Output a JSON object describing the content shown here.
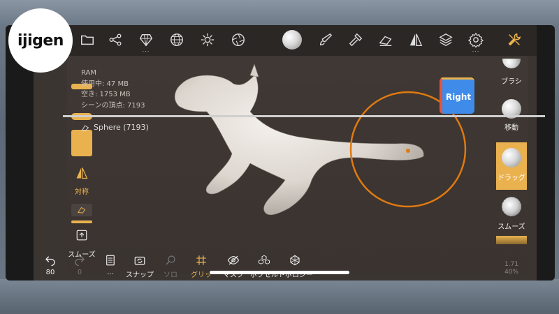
{
  "logo": {
    "text": "ijigen"
  },
  "ram": {
    "title": "RAM",
    "used": "使用中: 47 MB",
    "free": "空き: 1753 MB",
    "vertices": "シーンの頂点: 7193"
  },
  "object": {
    "name": "Sphere (7193)"
  },
  "navcube": {
    "label": "Right"
  },
  "left_panel": {
    "symmetry_label": "対称",
    "smooth_label": "スムーズ"
  },
  "right_panel": {
    "brush_label": "ブラシ",
    "move_label": "移動",
    "drag_label": "ドラッグ",
    "smooth_label": "スムーズ"
  },
  "bottom_toolbar": {
    "undo_count": "80",
    "redo_count": "0",
    "layers_dots": "...",
    "snap_label": "スナップ",
    "solo_label": "ソロ",
    "grid_label": "グリッ",
    "mask_label": "マスク",
    "voxel_label": "ボクセル",
    "topology_label": "トポロジー"
  },
  "zoom": {
    "line1": "1.71",
    "line2": "40%"
  },
  "colors": {
    "accent": "#e9b24f",
    "brush_ring": "#e07a10",
    "cube": "#3f8bea"
  }
}
